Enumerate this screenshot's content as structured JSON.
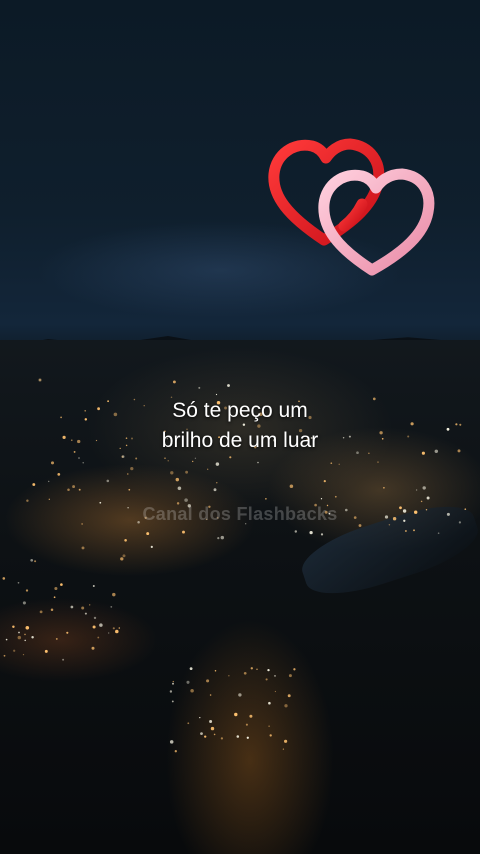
{
  "overlay": {
    "lyrics": [
      "Só te peço um",
      "brilho de um luar"
    ],
    "watermark": "Canal dos Flashbacks"
  },
  "decoration": {
    "icon": "interlocked-hearts-icon",
    "colors": {
      "heart_front": "#e81c24",
      "heart_back": "#f4a8c0"
    }
  },
  "background": {
    "description_colors": {
      "sky": "#0f1f2d",
      "city_lights": "#ffb04a"
    }
  }
}
